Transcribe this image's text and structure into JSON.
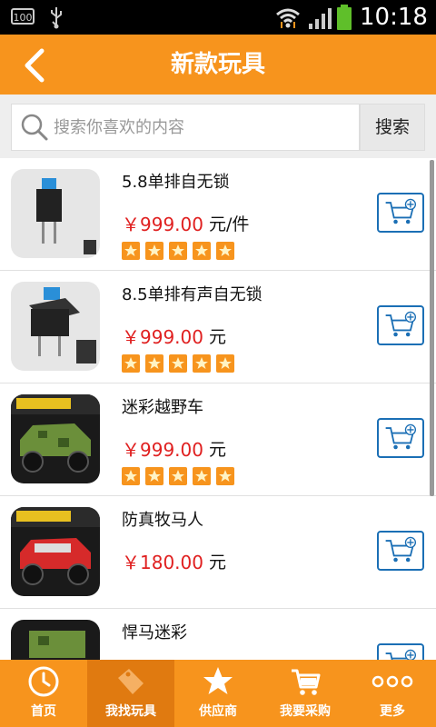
{
  "status_bar": {
    "battery_percent": "100",
    "time": "10:18"
  },
  "header": {
    "title": "新款玩具"
  },
  "search": {
    "placeholder": "搜索你喜欢的内容",
    "button_label": "搜索"
  },
  "products": [
    {
      "name": "5.8单排自无锁",
      "price": "￥999.00",
      "unit": "元/件",
      "rating": 5
    },
    {
      "name": "8.5单排有声自无锁",
      "price": "￥999.00",
      "unit": "元",
      "rating": 5
    },
    {
      "name": "迷彩越野车",
      "price": "￥999.00",
      "unit": "元",
      "rating": 5
    },
    {
      "name": "防真牧马人",
      "price": "￥180.00",
      "unit": "元",
      "rating": null
    },
    {
      "name": "悍马迷彩",
      "price": "",
      "unit": "",
      "rating": null
    }
  ],
  "tabs": [
    {
      "label": "首页",
      "icon": "clock-icon"
    },
    {
      "label": "我找玩具",
      "icon": "tag-icon"
    },
    {
      "label": "供应商",
      "icon": "star-icon"
    },
    {
      "label": "我要采购",
      "icon": "cart-icon"
    },
    {
      "label": "更多",
      "icon": "more-dots-icon"
    }
  ],
  "active_tab": 1,
  "colors": {
    "brand_orange": "#f7941d",
    "price_red": "#e02020",
    "cart_blue": "#1b6fb5",
    "star_orange": "#f7941d"
  }
}
